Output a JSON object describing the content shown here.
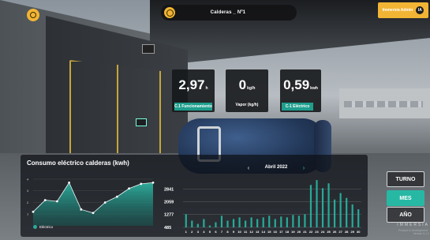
{
  "header": {
    "title": "Calderas _ Nº1",
    "user_name": "Immersia Admin",
    "user_initials": "IA"
  },
  "kpis": [
    {
      "value": "2,97",
      "unit": "h",
      "label": "C.1 Funcionamiento"
    },
    {
      "value": "0",
      "unit": "kg/h",
      "label": "Vapor (kg/h)"
    },
    {
      "value": "0,59",
      "unit": "kwh",
      "label": "C-1 Eléctrico"
    }
  ],
  "panel": {
    "title": "Consumo eléctrico calderas (kwh)",
    "period": "Abril 2022",
    "legend": "Eléctrico",
    "buttons": [
      "TURNO",
      "MES",
      "AÑO"
    ],
    "active_button": "MES"
  },
  "brand": {
    "name": "IMMERSIA",
    "sub": "Product in development · Version 0.1.1"
  },
  "colors": {
    "accent": "#f1b434",
    "teal": "#27b8a4"
  },
  "chart_data": [
    {
      "type": "area",
      "title": "Consumo eléctrico calderas (kwh)",
      "y_ticks": [
        1,
        2,
        3,
        4
      ],
      "values": [
        1.2,
        2.2,
        2.1,
        3.7,
        1.4,
        1.1,
        2.0,
        2.5,
        3.2,
        3.6,
        3.7
      ]
    },
    {
      "type": "bar",
      "categories": [
        "1",
        "2",
        "3",
        "4",
        "5",
        "6",
        "7",
        "8",
        "9",
        "10",
        "11",
        "12",
        "13",
        "14",
        "15",
        "16",
        "17",
        "18",
        "19",
        "20",
        "21",
        "22",
        "23",
        "24",
        "25",
        "26",
        "27",
        "28",
        "29",
        "30"
      ],
      "y_ticks": [
        485,
        1277,
        2059,
        2841
      ],
      "ylim": [
        485,
        3600
      ],
      "values": [
        1300,
        900,
        700,
        1000,
        600,
        800,
        1200,
        900,
        1000,
        1100,
        900,
        1100,
        1000,
        1100,
        1200,
        1000,
        1150,
        1100,
        1250,
        1200,
        1300,
        3100,
        3400,
        2900,
        3200,
        2200,
        2600,
        2300,
        1900,
        1600
      ]
    }
  ]
}
